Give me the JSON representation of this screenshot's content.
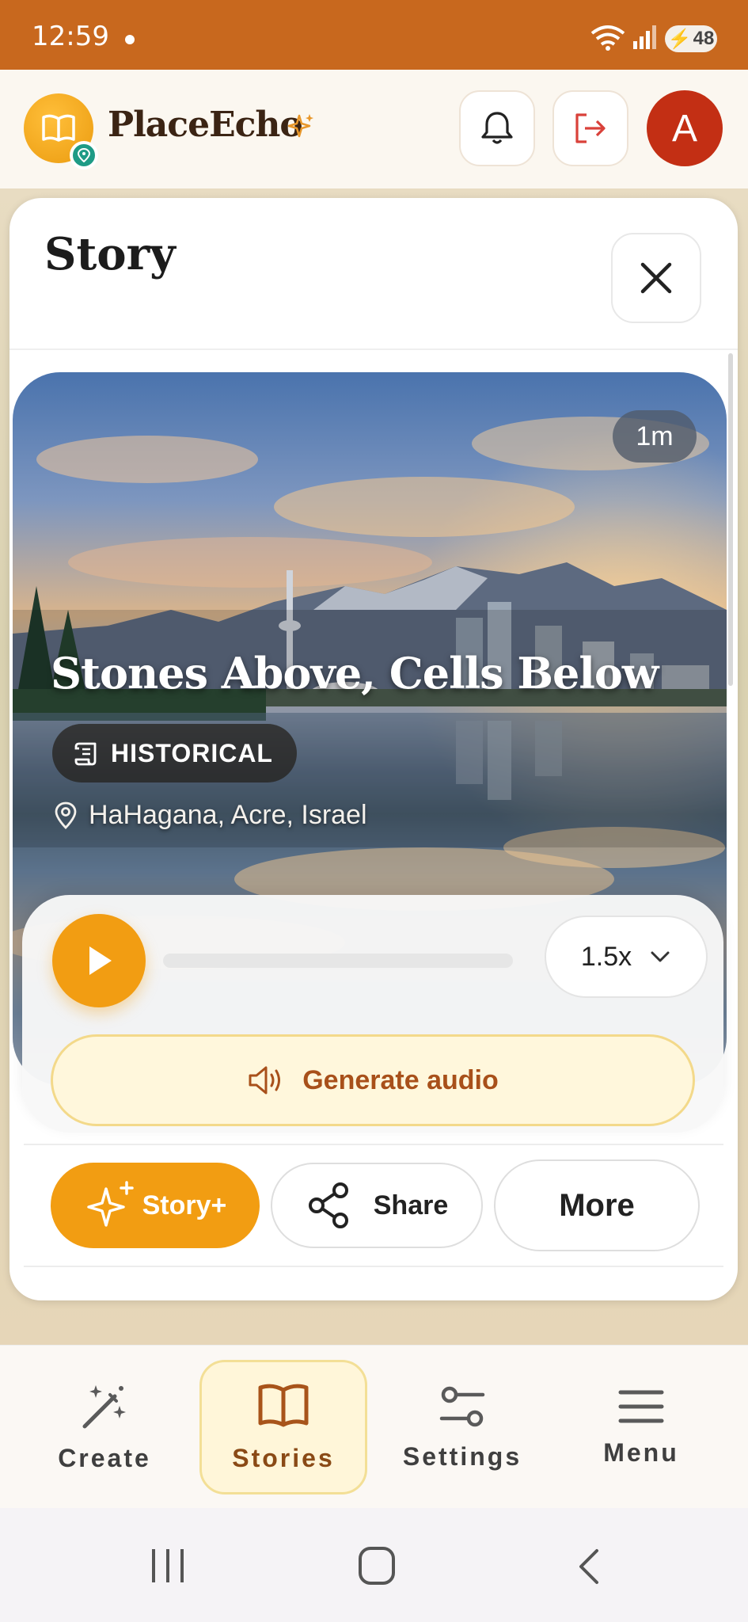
{
  "status_bar": {
    "time": "12:59",
    "battery": "48"
  },
  "header": {
    "app_name": "PlaceEcho",
    "avatar_letter": "A"
  },
  "sheet": {
    "title": "Story"
  },
  "story": {
    "duration": "1m",
    "title": "Stones Above, Cells Below",
    "genre": "HISTORICAL",
    "location": "HaHagana, Acre, Israel"
  },
  "player": {
    "progress": 0,
    "speed": "1.5x"
  },
  "actions": {
    "generate_audio": "Generate audio",
    "story_plus": "Story+",
    "share": "Share",
    "more": "More"
  },
  "nav": {
    "items": [
      {
        "label": "Create",
        "icon": "magic-wand-icon"
      },
      {
        "label": "Stories",
        "icon": "book-icon"
      },
      {
        "label": "Settings",
        "icon": "sliders-icon"
      },
      {
        "label": "Menu",
        "icon": "hamburger-icon"
      }
    ],
    "active": "Stories"
  },
  "colors": {
    "status_bar": "#c8681e",
    "accent": "#f29d12",
    "avatar": "#c32f14",
    "teal": "#1e9b86"
  }
}
